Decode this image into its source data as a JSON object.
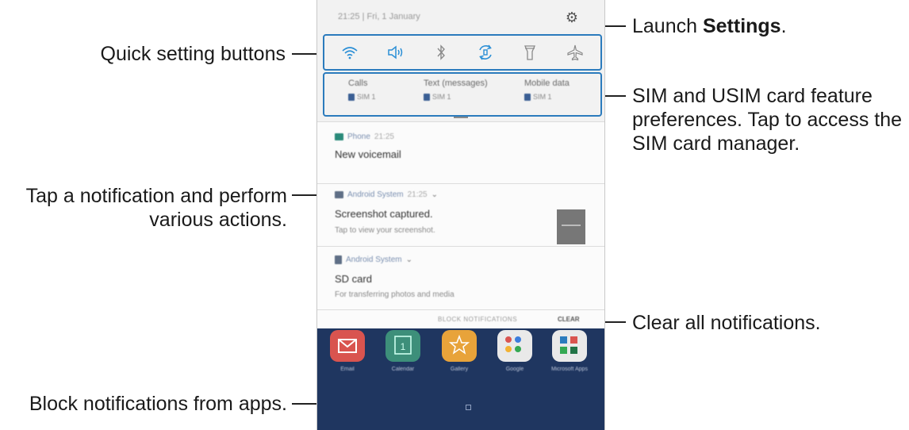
{
  "callouts": {
    "quick_settings": "Quick setting buttons",
    "launch_prefix": "Launch ",
    "launch_bold": "Settings",
    "launch_suffix": ".",
    "sim_line1": "SIM and USIM card feature",
    "sim_line2": "preferences. Tap to access the",
    "sim_line3": "SIM card manager.",
    "tap_line1": "Tap a notification and perform",
    "tap_line2": "various actions.",
    "clear_all": "Clear all notifications.",
    "block": "Block notifications from apps."
  },
  "status_bar": {
    "time_date": "21:25 | Fri, 1 January",
    "settings_icon": "gear-icon"
  },
  "quick_settings": [
    {
      "name": "wifi",
      "icon": "wifi-icon",
      "active": true
    },
    {
      "name": "sound",
      "icon": "speaker-icon",
      "active": true
    },
    {
      "name": "bluetooth",
      "icon": "bluetooth-icon",
      "active": false
    },
    {
      "name": "auto-rotate",
      "icon": "rotate-icon",
      "active": true
    },
    {
      "name": "flashlight",
      "icon": "flashlight-icon",
      "active": false
    },
    {
      "name": "airplane",
      "icon": "airplane-icon",
      "active": false
    }
  ],
  "sim": [
    {
      "label": "Calls",
      "value": "SIM 1"
    },
    {
      "label": "Text (messages)",
      "value": "SIM 1"
    },
    {
      "label": "Mobile data",
      "value": "SIM 1"
    }
  ],
  "notifications": [
    {
      "app": "Phone",
      "time": "21:25",
      "title": "New voicemail",
      "subtitle": ""
    },
    {
      "app": "Android System",
      "time": "21:25",
      "title": "Screenshot captured.",
      "subtitle": "Tap to view your screenshot."
    },
    {
      "app": "Android System",
      "time": "",
      "title": "SD card",
      "subtitle": "For transferring photos and media"
    }
  ],
  "actions": {
    "block": "BLOCK NOTIFICATIONS",
    "clear": "CLEAR"
  },
  "home_apps": [
    {
      "label": "Email",
      "color": "#d9544f"
    },
    {
      "label": "Calendar",
      "color": "#3d8f7a"
    },
    {
      "label": "Gallery",
      "color": "#e8a33a"
    },
    {
      "label": "Google",
      "color": "#e9e9e9"
    },
    {
      "label": "Microsoft Apps",
      "color": "#e9e9e9"
    }
  ],
  "colors": {
    "accent": "#2b7bbd",
    "active_icon": "#2b8fd6",
    "inactive_icon": "#8a8a8a"
  }
}
